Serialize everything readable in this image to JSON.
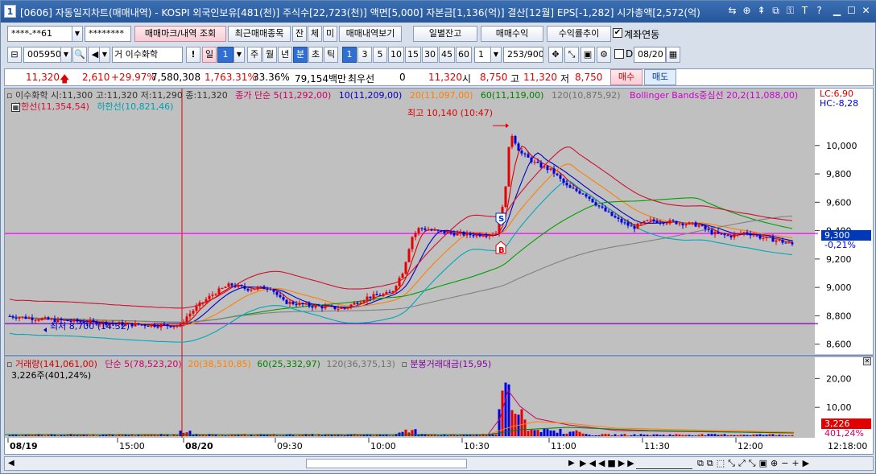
{
  "title_bar": {
    "number": "1",
    "text": "[0606] 자동일지차트(매매내역) - KOSPI 외국인보유[481(천)] 주식수[22,723(천)] 액면[5,000] 자본금[1,136(억)] 결산[12월] EPS[-1,282] 시가총액[2,572(억)"
  },
  "toolbar1": {
    "account": "****-**61",
    "password": "********",
    "btn_mark": "매매마크/내역 조회",
    "btn_recent": "최근매매종목",
    "tabs": [
      "잔",
      "체",
      "미"
    ],
    "btn_view": "매매내역보기",
    "btn_daily": "일별잔고",
    "btn_return": "매매수익",
    "btn_trend": "수익률추이",
    "chk_link": "계좌연동"
  },
  "toolbar2": {
    "code": "005950",
    "market": "거",
    "name": "이수화학",
    "excl": "!",
    "period_label": "일",
    "period_num": "1",
    "period_tabs": [
      "주",
      "월",
      "년",
      "분",
      "초",
      "틱"
    ],
    "active_period": "분",
    "minutes": [
      "1",
      "3",
      "5",
      "10",
      "15",
      "30",
      "45",
      "60"
    ],
    "active_minute": "1",
    "count_sel": "1",
    "bar_count": "253",
    "bar_total": "/900",
    "d_label": "D",
    "date": "08/20"
  },
  "quote": {
    "price": "11,320",
    "change": "2,610",
    "change_pct": "+29.97%",
    "volume": "7,580,308",
    "volume_pct": "1,763.31%",
    "turnover": "33.36%",
    "amount": "79,154백만",
    "best_label": "최우선",
    "best_val": "0",
    "cur": "11,320",
    "open_label": "시",
    "open": "8,750",
    "high_label": "고",
    "high": "11,320",
    "low_label": "저",
    "low": "8,750",
    "buy_btn": "매수",
    "sell_btn": "매도"
  },
  "price_panel": {
    "legend": {
      "ohlc": "이수화학 시:11,300 고:11,320 저:11,290 종:11,320",
      "ma_title": "종가 단순 5(11,292,00)",
      "ma10": "10(11,209,00)",
      "ma20": "20(11,097,00)",
      "ma60": "60(11,119,00)",
      "ma120": "120(10,875,92)",
      "bb": "Bollinger Bands중심선 20,2(11,088,00)",
      "bb_upper": "상한선(11,354,54)",
      "bb_lower": "하한선(10,821,46)"
    },
    "corner_lc": "LC:6,90",
    "corner_hc": "HC:-8,28",
    "high_annot": "최고 10,140 (10:47)",
    "low_annot": "최저 8,700 (14:32)",
    "price_label": "9,300",
    "price_label_pct": "-0,21%",
    "marker_s": "S",
    "marker_b": "B"
  },
  "volume_panel": {
    "legend": {
      "vol": "거래량(141,061,00)",
      "ma5": "단순 5(78,523,20)",
      "ma20": "20(38,510,85)",
      "ma60": "60(25,332,97)",
      "ma120": "120(36,375,13)",
      "amount": "분봉거래대금(15,95)"
    },
    "sub": "3,226주(401,24%)",
    "vol_label": "3,226",
    "vol_label_pct": "401,24%"
  },
  "x_axis": {
    "labels": [
      "08/19",
      "15:00",
      "08/20",
      "09:30",
      "10:00",
      "10:30",
      "11:00",
      "11:30",
      "12:00"
    ],
    "last": "12:18:00"
  },
  "colors": {
    "price_bg": "#c0c0c0",
    "up": "#e60000",
    "down": "#0000e0",
    "ma5": "#e00000",
    "ma10": "#0000c0",
    "ma20": "#ff8000",
    "ma60": "#00a000",
    "ma120": "#808080",
    "bb": "#d01030",
    "bb_lower": "#00a8b8",
    "ref_line": "#ff00ff",
    "low_line": "#8000c0"
  },
  "chart_data": {
    "type": "candlestick",
    "price_axis": {
      "ticks": [
        8600,
        8800,
        9000,
        9200,
        9400,
        9600,
        9800,
        10000
      ],
      "range": [
        8530,
        10220
      ]
    },
    "volume_axis": {
      "ticks": [
        "10,00",
        "20,00"
      ]
    },
    "reference_price": 9380,
    "low_reference": 8745,
    "last_price": 9300
  }
}
